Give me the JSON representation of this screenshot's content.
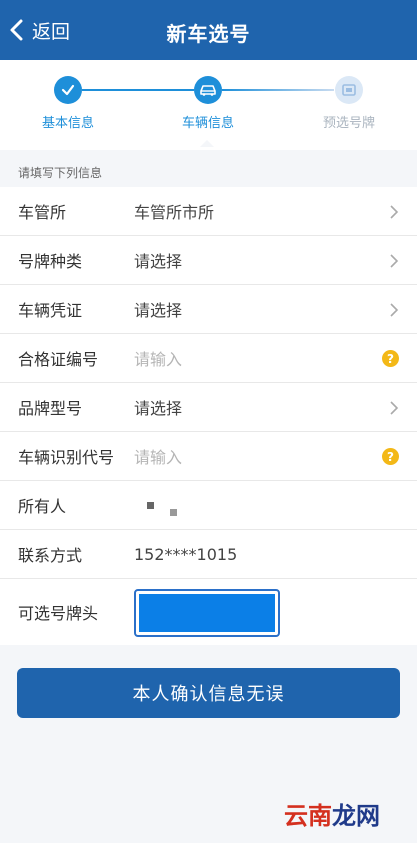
{
  "header": {
    "back_label": "返回",
    "title": "新车选号"
  },
  "steps": [
    {
      "label": "基本信息",
      "state": "done"
    },
    {
      "label": "车辆信息",
      "state": "active"
    },
    {
      "label": "预选号牌",
      "state": "pending"
    }
  ],
  "hint": "请填写下列信息",
  "form": {
    "rows": [
      {
        "label": "车管所",
        "value": "车管所市所"
      },
      {
        "label": "号牌种类",
        "value": "请选择"
      },
      {
        "label": "车辆凭证",
        "value": "请选择"
      },
      {
        "label": "合格证编号",
        "placeholder": "请输入"
      },
      {
        "label": "品牌型号",
        "value": "请选择"
      },
      {
        "label": "车辆识别代号",
        "placeholder": "请输入"
      },
      {
        "label": "所有人"
      },
      {
        "label": "联系方式",
        "value": "152****1015"
      },
      {
        "label": "可选号牌头"
      }
    ]
  },
  "help_glyph": "?",
  "confirm_label": "本人确认信息无误",
  "watermark": {
    "part1": "云",
    "part2": "南",
    "part3": "龙网"
  },
  "colors": {
    "brand": "#1f64ad",
    "step_active": "#1e8fd9",
    "help": "#f3b817",
    "plate_fill": "#0b7fe7"
  }
}
